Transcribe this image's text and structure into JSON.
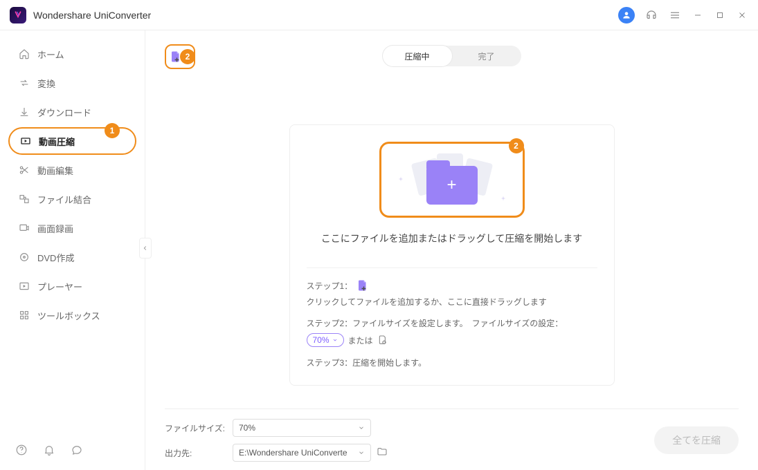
{
  "app": {
    "title": "Wondershare UniConverter"
  },
  "sidebar": {
    "items": [
      {
        "label": "ホーム"
      },
      {
        "label": "変換"
      },
      {
        "label": "ダウンロード"
      },
      {
        "label": "動画圧縮"
      },
      {
        "label": "動画編集"
      },
      {
        "label": "ファイル結合"
      },
      {
        "label": "画面録画"
      },
      {
        "label": "DVD作成"
      },
      {
        "label": "プレーヤー"
      },
      {
        "label": "ツールボックス"
      }
    ]
  },
  "callouts": {
    "one": "1",
    "two_a": "2",
    "two_b": "2"
  },
  "tabs": {
    "active": "圧縮中",
    "done": "完了"
  },
  "dropzone": {
    "text": "ここにファイルを追加またはドラッグして圧縮を開始します"
  },
  "steps": {
    "s1_label": "ステップ1：",
    "s1_text": "クリックしてファイルを追加するか、ここに直接ドラッグします",
    "s2_label": "ステップ2：ファイルサイズを設定します。",
    "s2_setting_label": "ファイルサイズの設定：",
    "s2_percent": "70%",
    "s2_or": "または",
    "s3": "ステップ3：圧縮を開始します。"
  },
  "bottom": {
    "filesize_label": "ファイルサイズ:",
    "filesize_value": "70%",
    "output_label": "出力先:",
    "output_value": "E:\\Wondershare UniConverte",
    "compress_all": "全てを圧縮"
  }
}
